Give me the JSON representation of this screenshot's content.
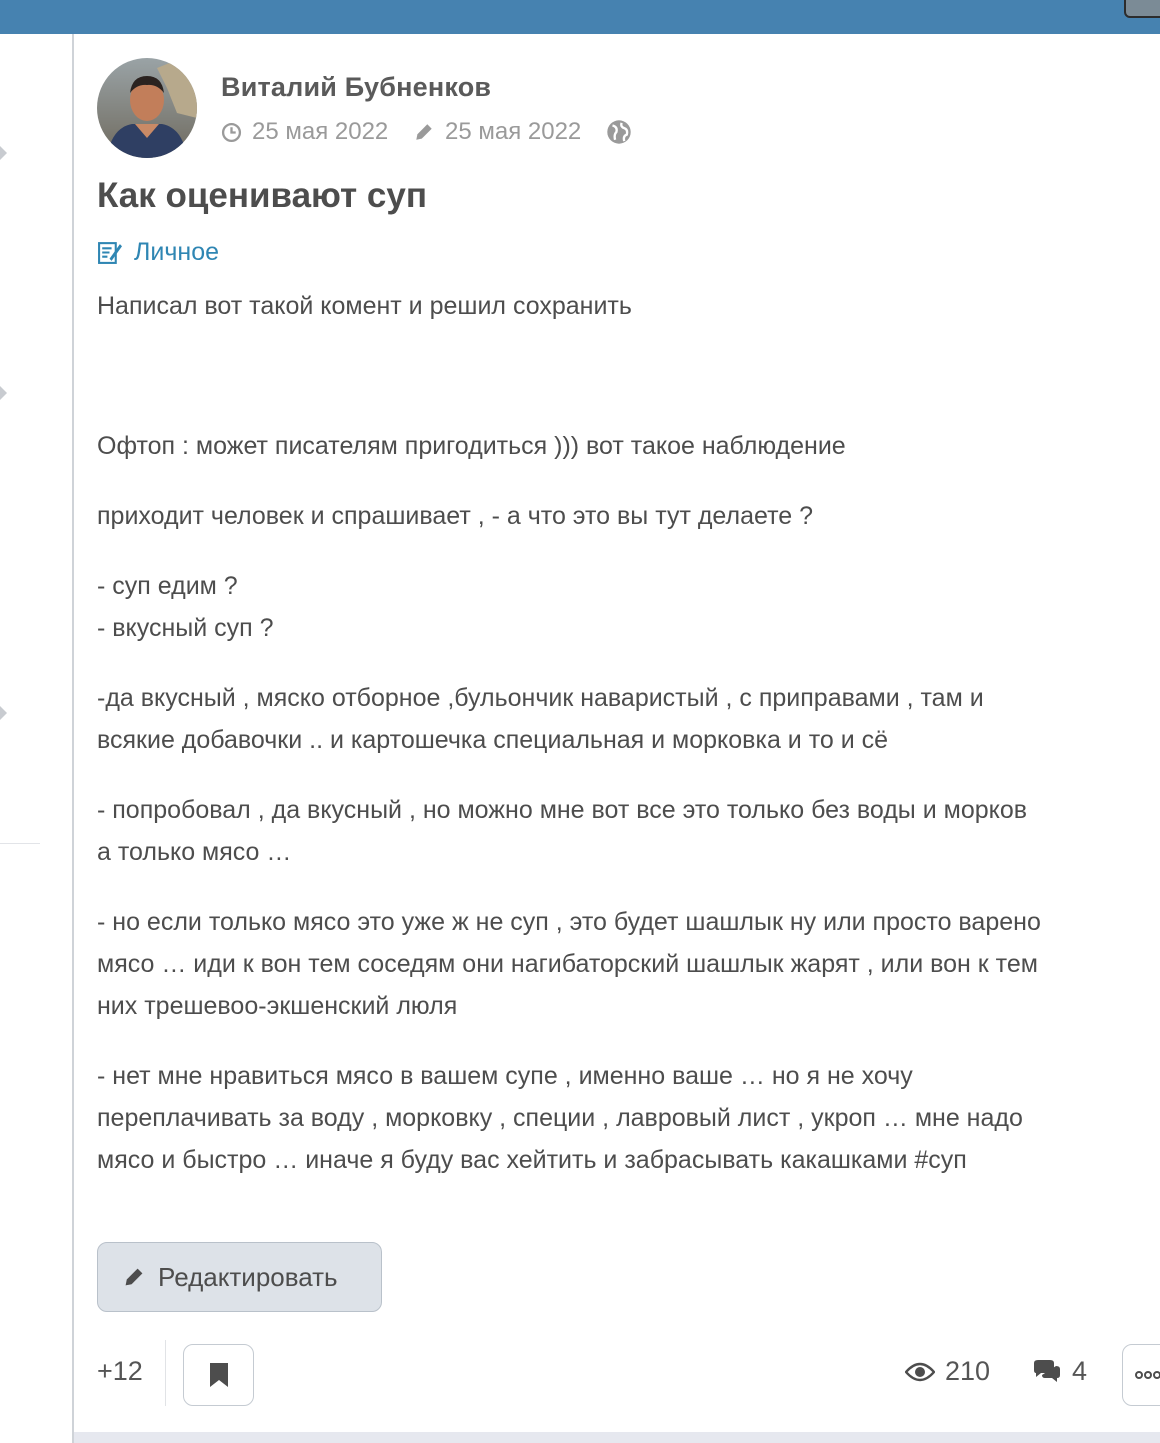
{
  "post": {
    "author": "Виталий Бубненков",
    "created_date": "25 мая 2022",
    "edited_date": "25 мая 2022",
    "title": "Как оценивают суп",
    "category": "Личное",
    "paragraphs": {
      "p1": "Написал вот такой комент и решил сохранить",
      "p2": "Офтоп : может писателям пригодиться ))) вот такое наблюдение",
      "p3": "приходит человек и спрашивает , - а что это вы тут делаете ?",
      "p4a": "- суп едим ?",
      "p4b": "- вкусный суп ?",
      "p5a": "-да вкусный , мяско отборное ,бульончик наваристый , с приправами , там и",
      "p5b": "всякие добавочки .. и картошечка специальная и морковка и то и сё",
      "p6a": "- попробовал , да вкусный , но можно мне вот все это только без воды и морков",
      "p6b": "а только мясо …",
      "p7a": "- но если только мясо это уже ж не суп , это будет шашлык ну или просто варено",
      "p7b": "мясо  … иди к вон тем соседям они нагибаторский шашлык жарят , или вон к тем",
      "p7c": "них трешевоо-экшенский люля",
      "p8a": "- нет мне нравиться мясо в вашем супе , именно ваше … но я не хочу",
      "p8b": "переплачивать за воду , морковку , специи , лавровый лист , укроп … мне надо",
      "p8c": "мясо и быстро … иначе я буду вас хейтить и забрасывать какашками #суп"
    }
  },
  "actions": {
    "edit_label": "Редактировать",
    "score": "+12",
    "views": "210",
    "comments": "4"
  },
  "icons": {
    "clock": "clock-icon",
    "pencil": "pencil-icon",
    "globe": "globe-icon",
    "category": "notebook-icon",
    "bookmark": "bookmark-icon",
    "views": "eye-icon",
    "comments": "comments-icon",
    "more": "more-icon"
  },
  "colors": {
    "topbar": "#4682b0",
    "link": "#2f86b3",
    "text": "#4d4d4d",
    "muted": "#9a9a9a",
    "button_bg": "#dde2e8"
  }
}
